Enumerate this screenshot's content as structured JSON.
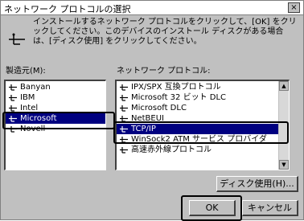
{
  "window": {
    "title": "ネットワーク プロトコルの選択",
    "close_label": "×"
  },
  "instructions": "インストールするネットワーク プロトコルをクリックして、[OK] をクリックしてください。このデバイスのインストール ディスクがある場合は、[ディスク使用] をクリックしてください。",
  "manufacturers": {
    "label": "製造元(M):",
    "items": [
      {
        "label": "Banyan"
      },
      {
        "label": "IBM"
      },
      {
        "label": "Intel"
      },
      {
        "label": "Microsoft",
        "selected": true
      },
      {
        "label": "Novell"
      }
    ]
  },
  "protocols": {
    "label": "ネットワーク プロトコル:",
    "items": [
      {
        "label": "IPX/SPX 互換プロトコル"
      },
      {
        "label": "Microsoft 32 ビット DLC"
      },
      {
        "label": "Microsoft DLC"
      },
      {
        "label": "NetBEUI"
      },
      {
        "label": "TCP/IP",
        "selected": true
      },
      {
        "label": "WinSock2 ATM サービス プロバイダ"
      },
      {
        "label": "高速赤外線プロトコル"
      }
    ]
  },
  "buttons": {
    "have_disk": "ディスク使用(H)...",
    "ok": "OK",
    "cancel": "キャンセル"
  }
}
